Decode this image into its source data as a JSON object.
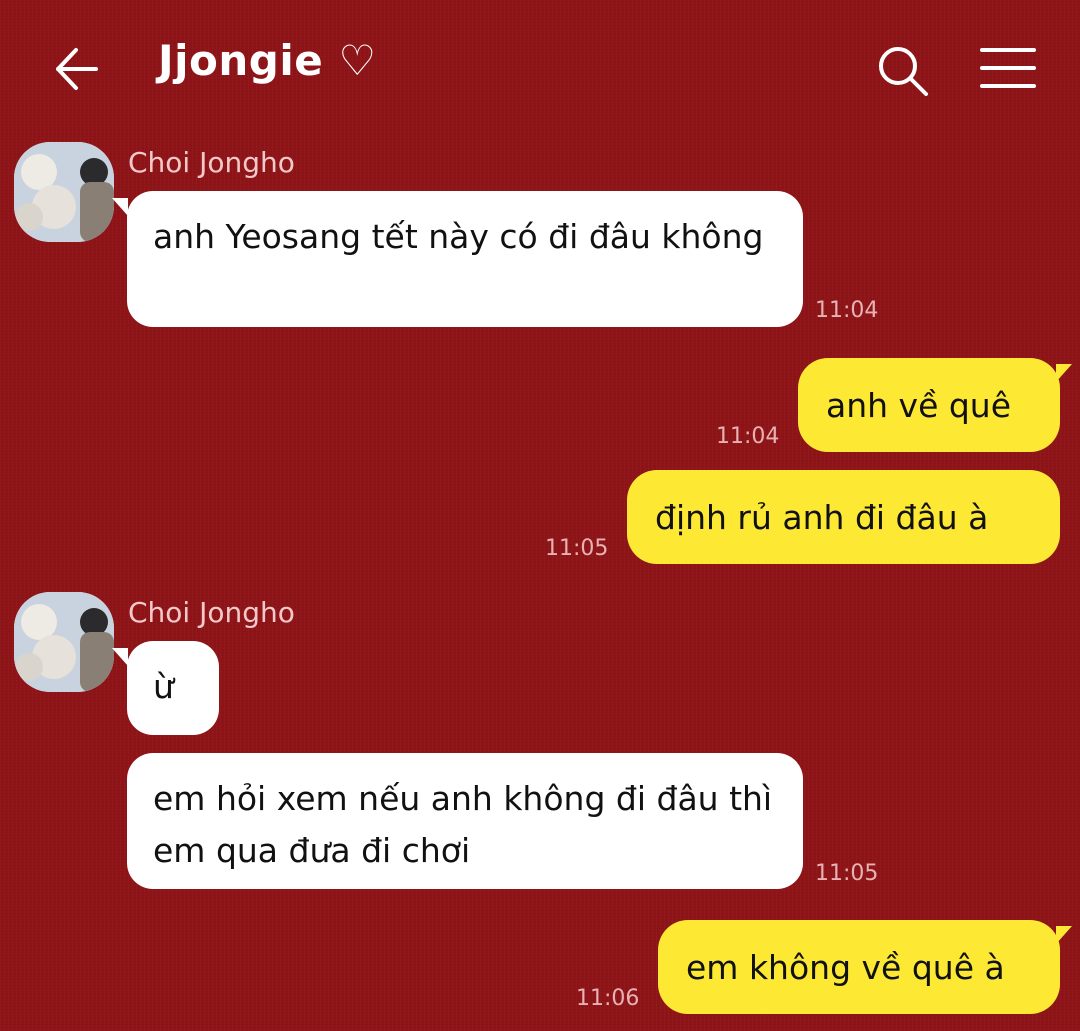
{
  "header": {
    "title": "Jjongie ♡",
    "back_icon": "arrow-left-icon",
    "search_icon": "search-icon",
    "menu_icon": "hamburger-menu-icon"
  },
  "colors": {
    "background": "#8f1418",
    "incoming_bubble": "#ffffff",
    "outgoing_bubble": "#fde933"
  },
  "messages": [
    {
      "sender": "Choi Jongho",
      "direction": "incoming",
      "text": "anh Yeosang tết này có đi đâu không",
      "time": "11:04"
    },
    {
      "direction": "outgoing",
      "text": "anh về quê",
      "time": "11:04"
    },
    {
      "direction": "outgoing",
      "text": "định rủ anh đi đâu à",
      "time": "11:05"
    },
    {
      "sender": "Choi Jongho",
      "direction": "incoming",
      "text": "ừ",
      "time": ""
    },
    {
      "direction": "incoming",
      "text": "em hỏi xem nếu anh không đi đâu thì em qua đưa đi chơi",
      "time": "11:05"
    },
    {
      "direction": "outgoing",
      "text": "em không về quê à",
      "time": "11:06"
    }
  ]
}
